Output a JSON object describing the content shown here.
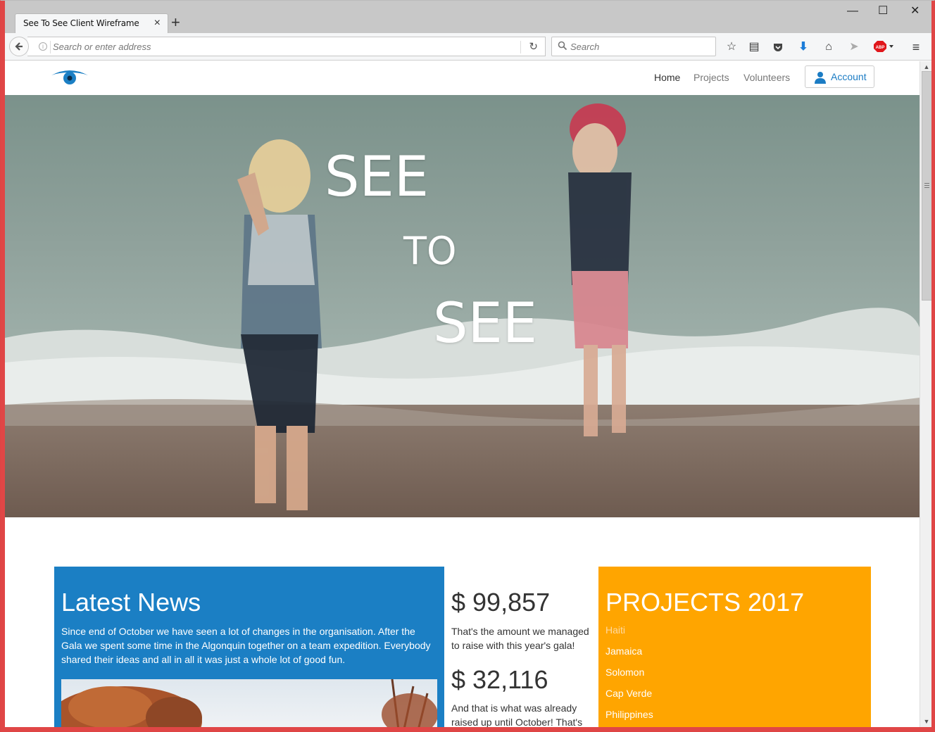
{
  "browser": {
    "tab_title": "See To See Client Wireframe",
    "tab_close": "×",
    "new_tab": "+",
    "url_placeholder": "Search or enter address",
    "search_placeholder": "Search",
    "window_controls": [
      "—",
      "☐",
      "✕"
    ]
  },
  "site": {
    "nav": {
      "items": [
        {
          "label": "Home",
          "active": true
        },
        {
          "label": "Projects",
          "active": false
        },
        {
          "label": "Volunteers",
          "active": false
        }
      ],
      "account_label": "Account"
    },
    "hero": {
      "words": [
        "SEE",
        "TO",
        "SEE"
      ]
    },
    "news": {
      "title": "Latest News",
      "body": "Since end of October we have seen a lot of changes in the organisation. After the Gala we spent some time in the Algonquin together on a team expedition. Everybody shared their ideas and all in all it was just a whole lot of good fun."
    },
    "stats": [
      {
        "amount": "$ 99,857",
        "text": "That's the amount we managed to raise with this year's gala!"
      },
      {
        "amount": "$ 32,116",
        "text": "And that is what was already raised up until October! That's"
      }
    ],
    "projects": {
      "title": "PROJECTS 2017",
      "items": [
        "Haiti",
        "Jamaica",
        "Solomon",
        "Cap Verde",
        "Philippines"
      ]
    }
  },
  "colors": {
    "brand_blue": "#1b7fc4",
    "projects_orange": "#ffa500",
    "window_border": "#e04646"
  }
}
